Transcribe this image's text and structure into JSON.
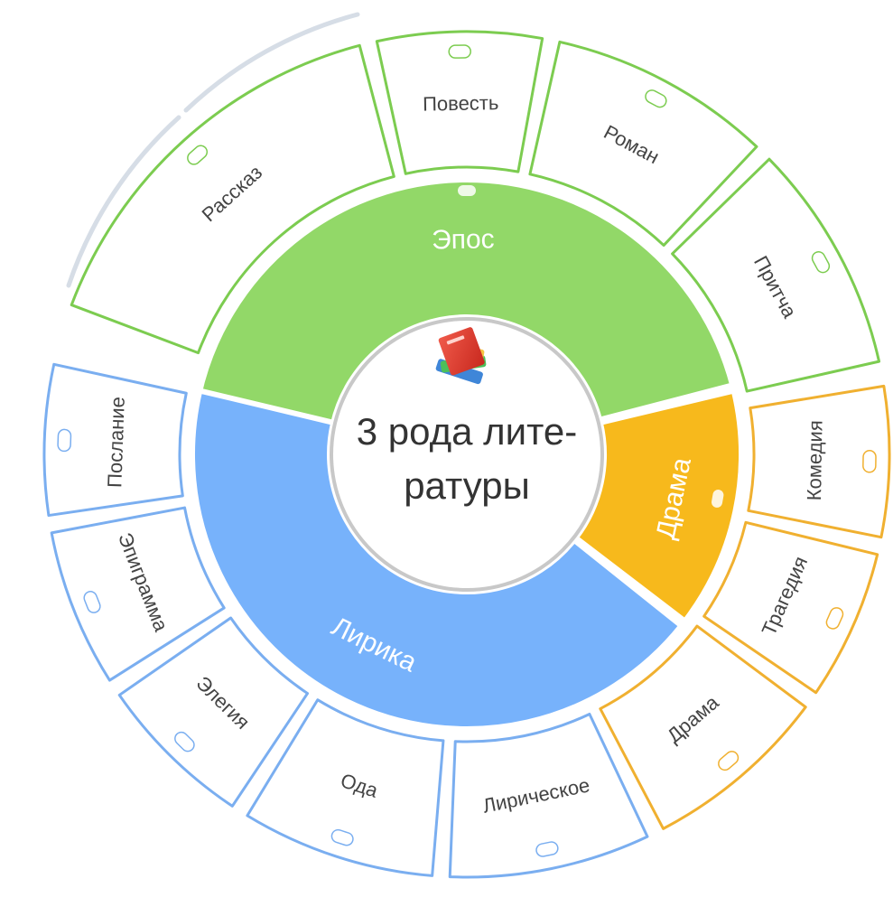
{
  "center": {
    "line1": "3 рода лите-",
    "line2": "ратуры",
    "icon": "books-icon"
  },
  "colors": {
    "epos": "#92d868",
    "epos_border": "#7ccc50",
    "drama": "#f7b91c",
    "drama_border": "#f0b030",
    "lyrics": "#77b2fb",
    "lyrics_border": "#7aaef0",
    "center_ring": "#c8c8c8"
  },
  "genres": [
    {
      "key": "epos",
      "label": "Эпос",
      "subgenres": [
        "Рассказ",
        "Повесть",
        "Роман",
        "Притча"
      ]
    },
    {
      "key": "drama",
      "label": "Драма",
      "subgenres": [
        "Комедия",
        "Трагедия",
        "Драма"
      ]
    },
    {
      "key": "lyrics",
      "label": "Лирика",
      "subgenres": [
        "Лирическое",
        "Ода",
        "Элегия",
        "Эпиграмма",
        "Послание"
      ]
    }
  ]
}
